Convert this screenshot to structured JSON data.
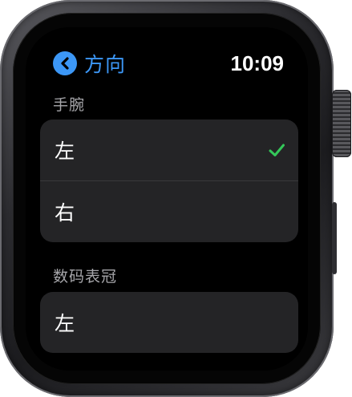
{
  "nav": {
    "back_title": "方向",
    "back_icon": "chevron-left-icon",
    "time": "10:09",
    "accent_color": "#3c97f6"
  },
  "wrist_section": {
    "header": "手腕",
    "options": [
      {
        "label": "左",
        "selected": true
      },
      {
        "label": "右",
        "selected": false
      }
    ]
  },
  "crown_section": {
    "header": "数码表冠",
    "options": [
      {
        "label": "左",
        "selected": false
      }
    ]
  },
  "colors": {
    "background": "#000000",
    "cell_background": "#242426",
    "header_text": "#a6a6aa",
    "check": "#34c759"
  }
}
